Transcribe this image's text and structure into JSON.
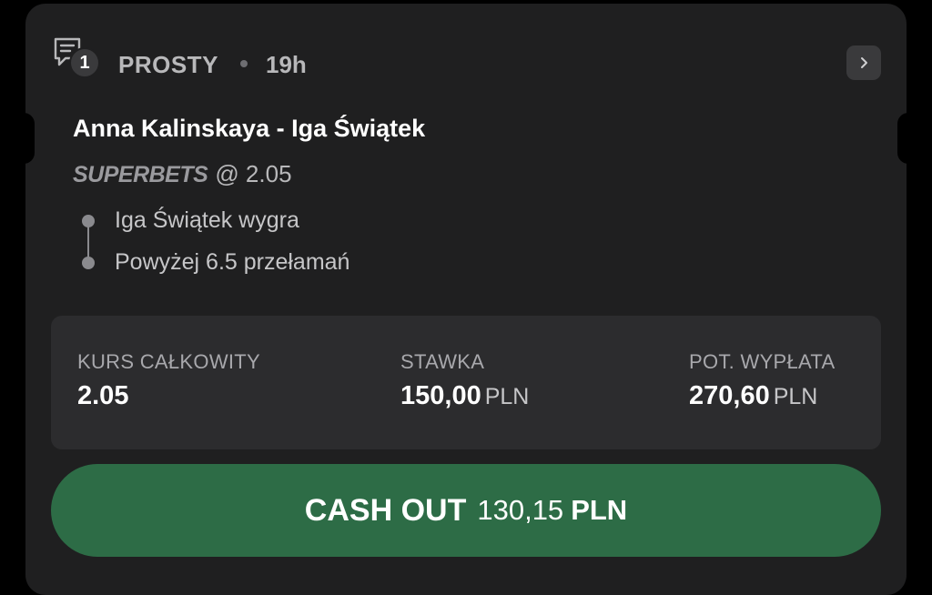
{
  "header": {
    "selections_count": "1",
    "bet_type": "PROSTY",
    "time_ago": "19h",
    "icons": {
      "bet": "bet-slip-icon",
      "chevron": "chevron-right-icon"
    }
  },
  "event": {
    "title": "Anna Kalinskaya - Iga Świątek",
    "brand": "SUPERBETS",
    "odds": "@ 2.05"
  },
  "selections": [
    "Iga Świątek wygra",
    "Powyżej 6.5 przełamań"
  ],
  "summary": {
    "total_odds_label": "KURS CAŁKOWITY",
    "total_odds_value": "2.05",
    "stake_label": "STAWKA",
    "stake_value": "150,00",
    "stake_currency": "PLN",
    "payout_label": "POT. WYPŁATA",
    "payout_value": "270,60",
    "payout_currency": "PLN"
  },
  "cashout": {
    "label": "CASH OUT",
    "amount": "130,15",
    "currency": "PLN"
  },
  "colors": {
    "background": "#000000",
    "card": "#1f1f20",
    "panel": "#2c2c2e",
    "cashout_green": "#2d6c46"
  }
}
